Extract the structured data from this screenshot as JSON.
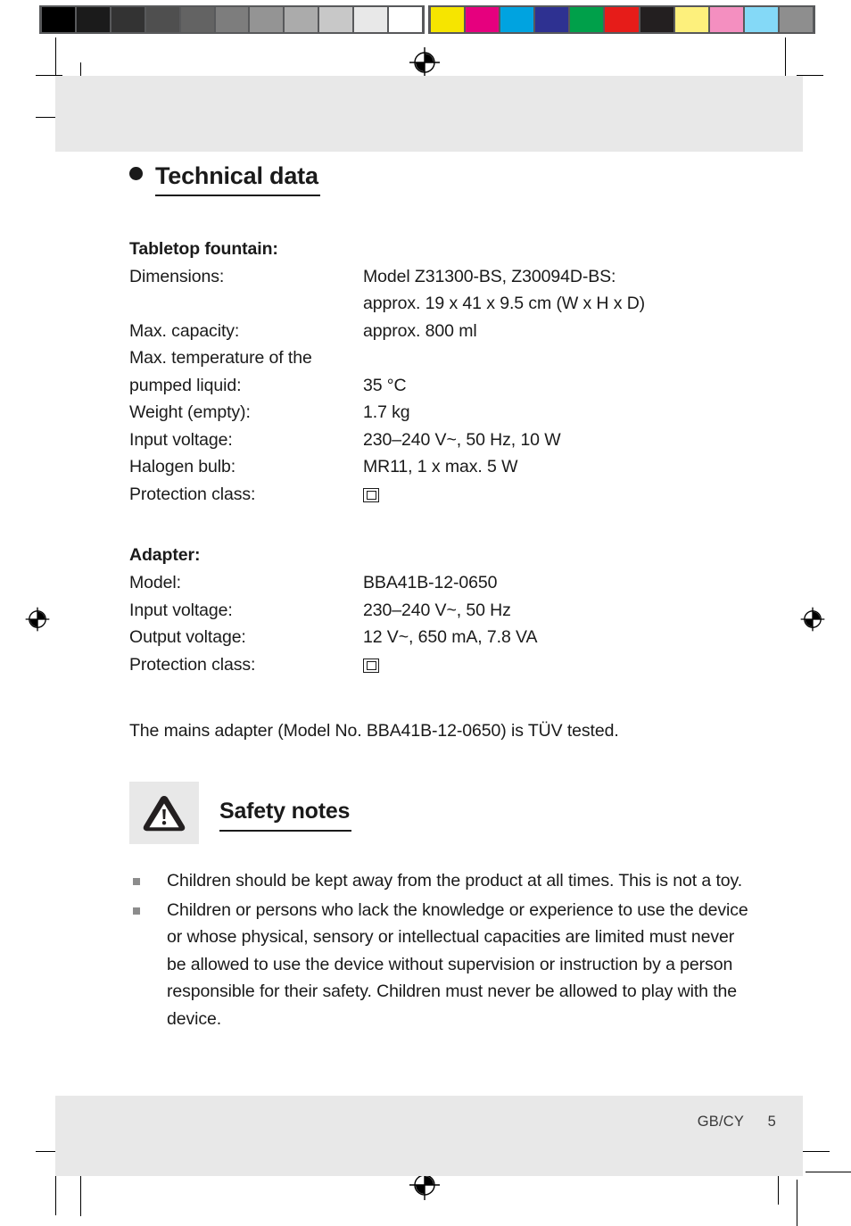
{
  "document": {
    "section_title": "Technical data",
    "title_bullet_icon": "filled-circle-bullet-icon",
    "footer": {
      "locale": "GB/CY",
      "page_number": "5"
    }
  },
  "tabletop_fountain": {
    "heading": "Tabletop fountain:",
    "rows": [
      {
        "label": "Dimensions:",
        "value": "Model Z31300-BS, Z30094D-BS:"
      },
      {
        "label": "",
        "value": "approx. 19 x 41 x 9.5 cm (W x H x D)"
      },
      {
        "label": "Max. capacity:",
        "value": "approx. 800 ml"
      },
      {
        "label": "Max. temperature of the",
        "value": ""
      },
      {
        "label": "pumped liquid:",
        "value": "35 °C"
      },
      {
        "label": "Weight (empty):",
        "value": "1.7 kg"
      },
      {
        "label": "Input voltage:",
        "value": "230–240 V~, 50 Hz, 10 W"
      },
      {
        "label": "Halogen bulb:",
        "value": "MR11, 1 x max. 5 W"
      },
      {
        "label": "Protection class:",
        "value": "",
        "symbol": "protection-class-2-icon"
      }
    ]
  },
  "adapter": {
    "heading": "Adapter:",
    "rows": [
      {
        "label": "Model:",
        "value": "BBA41B-12-0650"
      },
      {
        "label": "Input voltage:",
        "value": "230–240 V~, 50 Hz"
      },
      {
        "label": "Output voltage:",
        "value": "12 V~, 650 mA, 7.8 VA"
      },
      {
        "label": "Protection class:",
        "value": "",
        "symbol": "protection-class-2-icon"
      }
    ]
  },
  "tuv_note": "The mains adapter (Model No. BBA41B-12-0650) is TÜV tested.",
  "safety_notes": {
    "heading": "Safety notes",
    "warning_icon": "warning-triangle-icon",
    "bullet_icon": "gray-square-bullet-icon",
    "items": [
      "Children should be kept away from the product at all times. This is not a toy.",
      "Children or persons who lack the knowledge or experience to use the device or whose physical, sensory or intellectual capacities are limited must never be allowed to use the device without supervision or instruction by a person responsible for their safety. Children must never be allowed to play with the device."
    ]
  },
  "print_marks": {
    "grayscale_strip": [
      "#000000",
      "#1b1b1b",
      "#333333",
      "#4f4f4f",
      "#636363",
      "#7d7d7d",
      "#949494",
      "#ababab",
      "#c8c8c8",
      "#e8e8e8",
      "#ffffff"
    ],
    "color_strip": [
      "#f6e500",
      "#e6007e",
      "#00a3e0",
      "#2e3191",
      "#00a04a",
      "#e61c19",
      "#231f20",
      "#fdf07c",
      "#f48fc0",
      "#84d9f7",
      "#8e8e8e"
    ],
    "strip_border_color": "#58595b",
    "registration_icon": "registration-target-icon"
  },
  "colors": {
    "panel_gray": "#e8e8e8",
    "text": "#1a1a1a",
    "bullet_gray": "#8c8c8c"
  }
}
